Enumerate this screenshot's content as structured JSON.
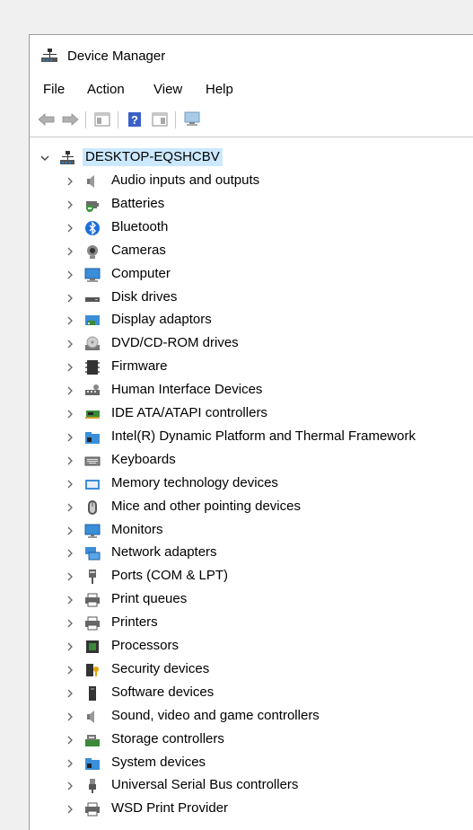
{
  "window": {
    "title": "Device Manager"
  },
  "menu": [
    "File",
    "Action",
    "View",
    "Help"
  ],
  "toolbar": {
    "buttons": [
      "back-arrow-icon",
      "forward-arrow-icon",
      "properties-icon",
      "help-icon",
      "details-pane-icon",
      "scan-hardware-icon"
    ]
  },
  "tree": {
    "root": {
      "label": "DESKTOP-EQSHCBV",
      "expanded": true
    },
    "items": [
      {
        "label": "Audio inputs and outputs",
        "icon": "speaker-icon"
      },
      {
        "label": "Batteries",
        "icon": "battery-icon"
      },
      {
        "label": "Bluetooth",
        "icon": "bluetooth-icon"
      },
      {
        "label": "Cameras",
        "icon": "camera-icon"
      },
      {
        "label": "Computer",
        "icon": "computer-icon"
      },
      {
        "label": "Disk drives",
        "icon": "disk-drive-icon"
      },
      {
        "label": "Display adaptors",
        "icon": "display-adapter-icon"
      },
      {
        "label": "DVD/CD-ROM drives",
        "icon": "dvd-drive-icon"
      },
      {
        "label": "Firmware",
        "icon": "firmware-icon"
      },
      {
        "label": "Human Interface Devices",
        "icon": "hid-icon"
      },
      {
        "label": "IDE ATA/ATAPI controllers",
        "icon": "ide-controller-icon"
      },
      {
        "label": "Intel(R) Dynamic Platform and Thermal Framework",
        "icon": "folder-device-icon"
      },
      {
        "label": "Keyboards",
        "icon": "keyboard-icon"
      },
      {
        "label": "Memory technology devices",
        "icon": "memory-device-icon"
      },
      {
        "label": "Mice and other pointing devices",
        "icon": "mouse-icon"
      },
      {
        "label": "Monitors",
        "icon": "monitor-icon"
      },
      {
        "label": "Network adapters",
        "icon": "network-adapter-icon"
      },
      {
        "label": "Ports (COM & LPT)",
        "icon": "port-icon"
      },
      {
        "label": "Print queues",
        "icon": "printer-icon"
      },
      {
        "label": "Printers",
        "icon": "printer-icon"
      },
      {
        "label": "Processors",
        "icon": "processor-icon"
      },
      {
        "label": "Security devices",
        "icon": "security-device-icon"
      },
      {
        "label": "Software devices",
        "icon": "software-device-icon"
      },
      {
        "label": "Sound, video and game controllers",
        "icon": "speaker-icon"
      },
      {
        "label": "Storage controllers",
        "icon": "storage-controller-icon"
      },
      {
        "label": "System devices",
        "icon": "folder-device-icon"
      },
      {
        "label": "Universal Serial Bus controllers",
        "icon": "usb-icon"
      },
      {
        "label": "WSD Print Provider",
        "icon": "printer-icon"
      }
    ]
  },
  "colors": {
    "selection": "#cce8ff",
    "accent": "#0078d7",
    "chevron": "#666666"
  }
}
